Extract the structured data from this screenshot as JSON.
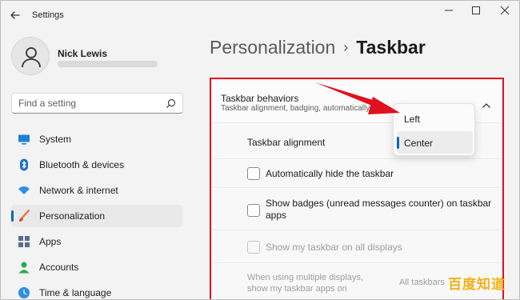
{
  "window": {
    "title": "Settings"
  },
  "user": {
    "name": "Nick Lewis"
  },
  "search": {
    "placeholder": "Find a setting"
  },
  "sidebar": {
    "items": [
      {
        "label": "System",
        "icon": "monitor-icon"
      },
      {
        "label": "Bluetooth & devices",
        "icon": "bluetooth-icon"
      },
      {
        "label": "Network & internet",
        "icon": "wifi-icon"
      },
      {
        "label": "Personalization",
        "icon": "brush-icon",
        "active": true
      },
      {
        "label": "Apps",
        "icon": "apps-grid-icon"
      },
      {
        "label": "Accounts",
        "icon": "person-icon"
      },
      {
        "label": "Time & language",
        "icon": "globe-clock-icon"
      }
    ]
  },
  "breadcrumb": {
    "parent": "Personalization",
    "separator": "›",
    "current": "Taskbar"
  },
  "section": {
    "title": "Taskbar behaviors",
    "subtitle": "Taskbar alignment, badging, automatically h"
  },
  "settings": {
    "alignment_label": "Taskbar alignment",
    "auto_hide_label": "Automatically hide the taskbar",
    "badges_label_line1": "Show badges (unread messages counter) on taskbar",
    "badges_label_line2": "apps",
    "all_displays_label": "Show my taskbar on all displays",
    "multi_display_line1": "When using multiple displays,",
    "multi_display_line2": "show my taskbar apps on",
    "multi_display_value": "All taskbars"
  },
  "dropdown": {
    "options": [
      "Left",
      "Center"
    ],
    "selected": "Center"
  },
  "watermark": {
    "text": "百度知道"
  },
  "colors": {
    "accent": "#0067c0",
    "highlight": "#e0101e",
    "watermark": "#f2b11a"
  }
}
